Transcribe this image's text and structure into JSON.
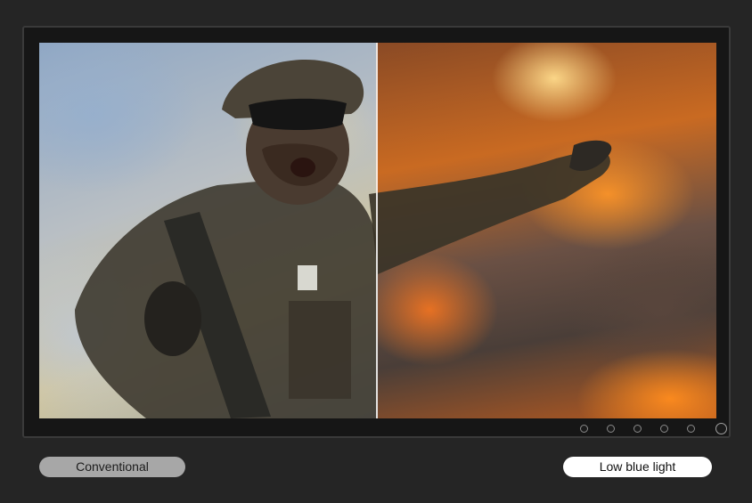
{
  "comparison": {
    "left_label": "Conventional",
    "right_label": "Low blue light"
  },
  "monitor": {
    "control_buttons": 5
  },
  "colors": {
    "background": "#252525",
    "conventional_pill": "#a7a7a7",
    "low_blue_light_pill": "#ffffff"
  }
}
